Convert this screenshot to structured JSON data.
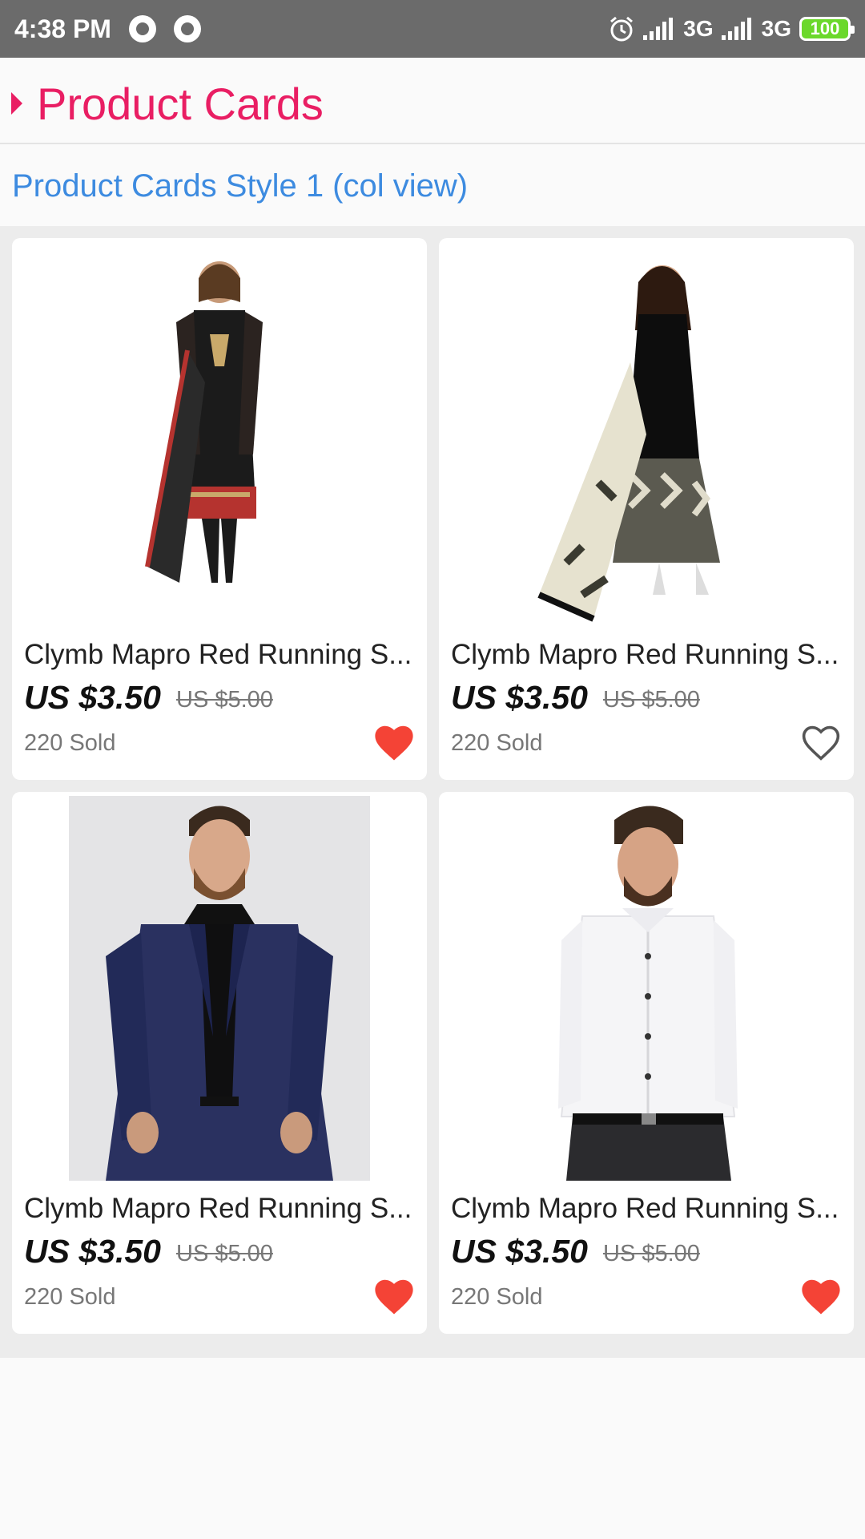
{
  "status_bar": {
    "time": "4:38 PM",
    "network_1": "3G",
    "network_2": "3G",
    "battery": "100"
  },
  "section": {
    "title": "Product Cards"
  },
  "subheader": {
    "title": "Product Cards Style 1 (col view)"
  },
  "products": [
    {
      "name": "Clymb Mapro Red Running S...",
      "price": "US $3.50",
      "old_price": "US $5.00",
      "sold": "220 Sold",
      "favorite": true,
      "image": "woman-black-salwar-suit"
    },
    {
      "name": "Clymb Mapro Red Running S...",
      "price": "US $3.50",
      "old_price": "US $5.00",
      "sold": "220 Sold",
      "favorite": false,
      "image": "woman-black-patiala-suit"
    },
    {
      "name": "Clymb Mapro Red Running S...",
      "price": "US $3.50",
      "old_price": "US $5.00",
      "sold": "220 Sold",
      "favorite": true,
      "image": "man-navy-blazer"
    },
    {
      "name": "Clymb Mapro Red Running S...",
      "price": "US $3.50",
      "old_price": "US $5.00",
      "sold": "220 Sold",
      "favorite": true,
      "image": "man-white-shirt"
    }
  ],
  "colors": {
    "accent_pink": "#e91e63",
    "link_blue": "#3d8be0",
    "heart_red": "#f44336"
  }
}
